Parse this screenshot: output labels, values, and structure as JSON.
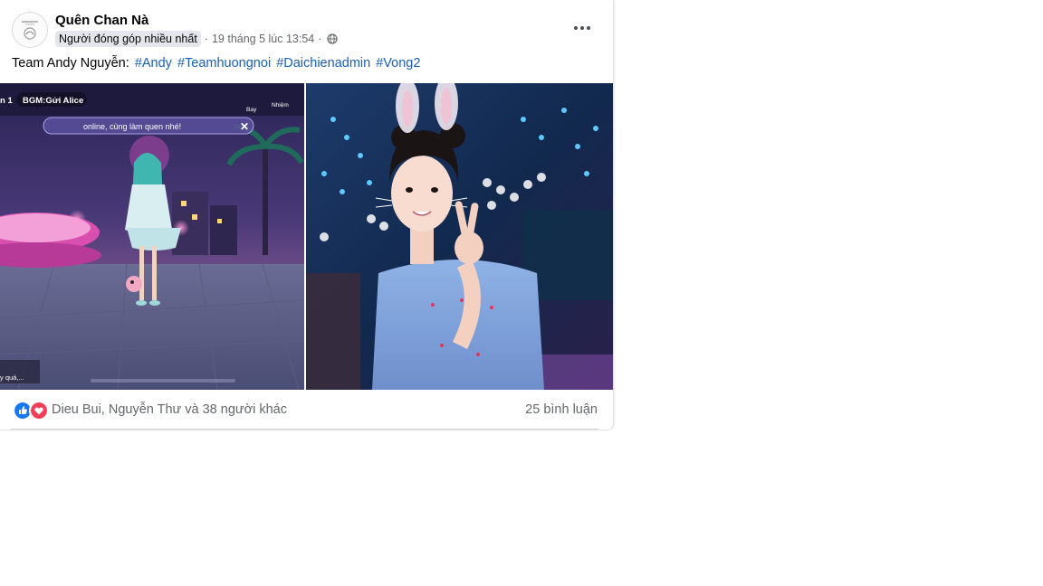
{
  "post": {
    "author_name": "Quên Chan Nà",
    "contributor_badge": "Người đóng góp nhiều nhất",
    "separator": "·",
    "timestamp": "19 tháng 5 lúc 13:54",
    "privacy_icon": "globe-icon",
    "more_icon": "more-horizontal-icon",
    "caption_text": "Team Andy Nguyễn: ",
    "hashtags": [
      "#Andy",
      "#Teamhuongnoi",
      "#Daichienadmin",
      "#Vong2"
    ]
  },
  "photos": {
    "game_overlay": {
      "bgm_label": "BGM:Gửi Alice",
      "channel_label": "n 1",
      "chat_line": "online, cùng làm quen nhé!",
      "top_right_1": "Bay",
      "top_right_2": "Nhiệm",
      "chat_input": "y quá,..."
    }
  },
  "reactions": {
    "icons": [
      "like-icon",
      "love-icon"
    ],
    "summary": "Dieu Bui, Nguyễn Thư và 38 người khác",
    "comments": "25 bình luận"
  },
  "colors": {
    "link": "#1a5fb4",
    "secondary_text": "#65676b",
    "like_blue": "#1877f2",
    "love_red": "#f33e58"
  }
}
